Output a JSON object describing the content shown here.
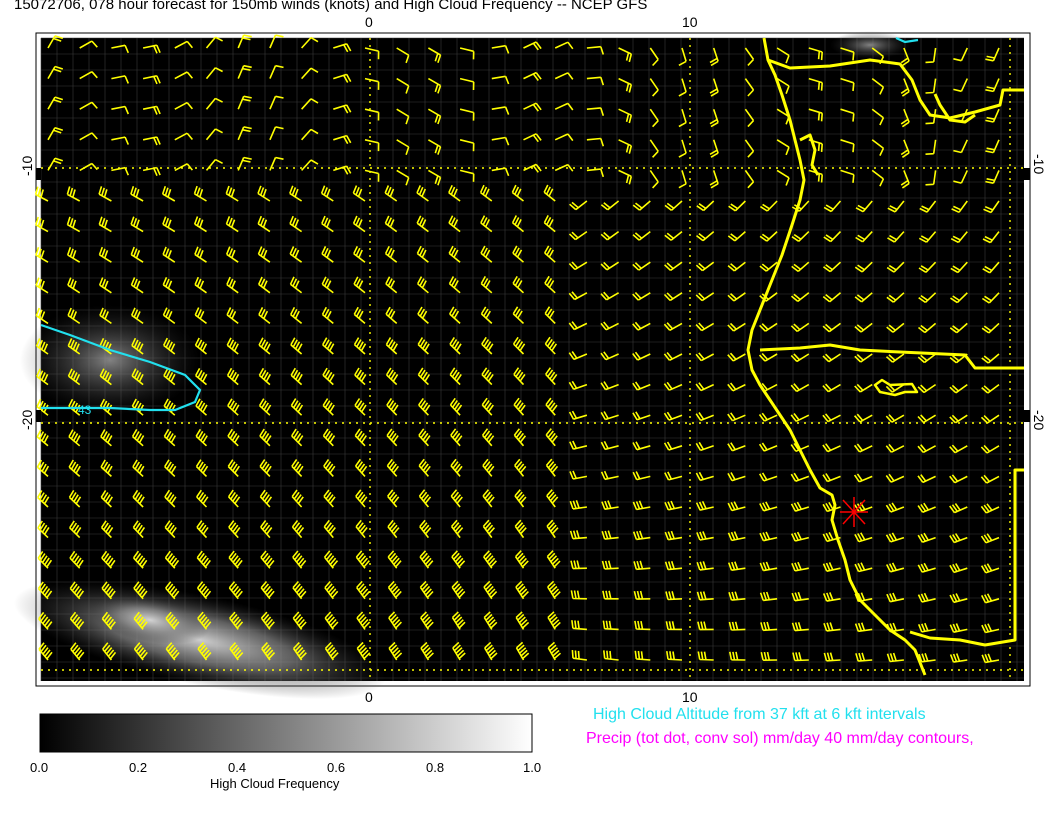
{
  "title": "15072706, 078 hour forecast for 150mb winds (knots) and High Cloud Frequency -- NCEP GFS",
  "map": {
    "x_ticks": [
      "0",
      "10"
    ],
    "y_ticks": [
      "-10",
      "-20"
    ],
    "contour_label": "43",
    "colors": {
      "background": "#000000",
      "wind_barbs": "#ffff00",
      "coastline": "#ffff00",
      "grid_dotted": "#ffff00",
      "cloud_contour": "#22e0ee",
      "station_marker": "#ff0000"
    },
    "wind_field_note": "150mb wind barbs over South Atlantic / SW Africa",
    "station_marker_icon": "asterisk-marker"
  },
  "colorbar": {
    "labels": [
      "0.0",
      "0.2",
      "0.4",
      "0.6",
      "0.8",
      "1.0"
    ],
    "title": "High Cloud Frequency"
  },
  "legend": {
    "cloud_altitude": "High Cloud Altitude from 37 kft at 6 kft intervals",
    "precip": "Precip (tot dot, conv sol) mm/day 40 mm/day contours,"
  }
}
